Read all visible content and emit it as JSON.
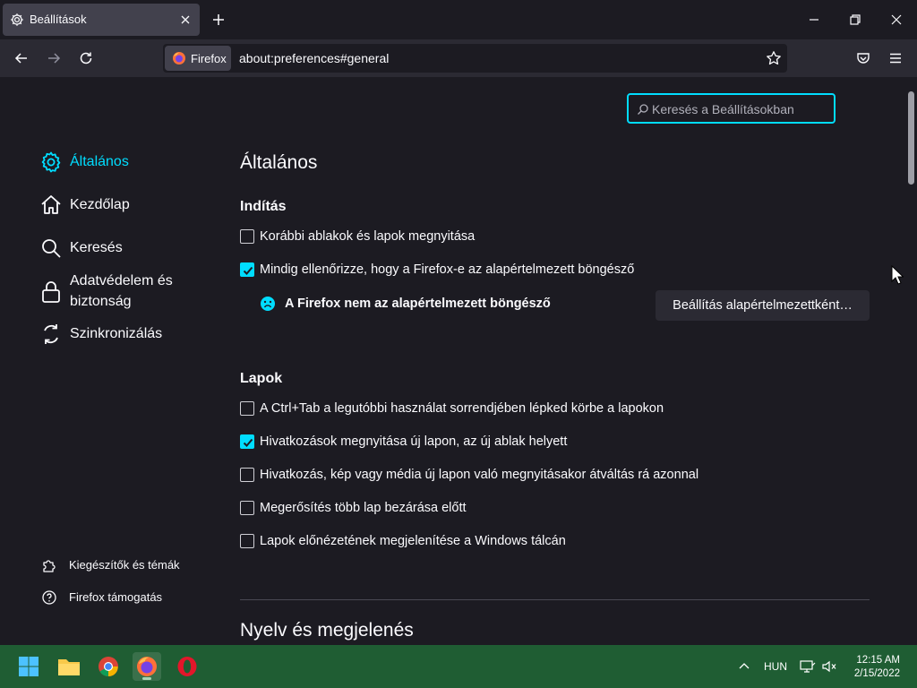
{
  "tab": {
    "title": "Beállítások"
  },
  "urlbar": {
    "identity_label": "Firefox",
    "url": "about:preferences#general"
  },
  "search": {
    "placeholder": "Keresés a Beállításokban"
  },
  "sidebar": {
    "items": [
      {
        "label": "Általános",
        "icon": "gear-icon",
        "active": true
      },
      {
        "label": "Kezdőlap",
        "icon": "home-icon"
      },
      {
        "label": "Keresés",
        "icon": "search-icon"
      },
      {
        "label": "Adatvédelem és biztonság",
        "icon": "lock-icon"
      },
      {
        "label": "Szinkronizálás",
        "icon": "sync-icon"
      }
    ],
    "footer": [
      {
        "label": "Kiegészítők és témák",
        "icon": "puzzle-icon"
      },
      {
        "label": "Firefox támogatás",
        "icon": "help-icon"
      }
    ]
  },
  "page": {
    "title": "Általános",
    "startup": {
      "heading": "Indítás",
      "restore_session": {
        "label": "Korábbi ablakok és lapok megnyitása",
        "checked": false
      },
      "check_default": {
        "label": "Mindig ellenőrizze, hogy a Firefox-e az alapértelmezett böngésző",
        "checked": true
      },
      "not_default_text": "A Firefox nem az alapértelmezett böngésző",
      "set_default_button": "Beállítás alapértelmezettként…"
    },
    "tabs": {
      "heading": "Lapok",
      "options": [
        {
          "label": "A Ctrl+Tab a legutóbbi használat sorrendjében lépked körbe a lapokon",
          "checked": false
        },
        {
          "label": "Hivatkozások megnyitása új lapon, az új ablak helyett",
          "checked": true
        },
        {
          "label": "Hivatkozás, kép vagy média új lapon való megnyitásakor átváltás rá azonnal",
          "checked": false
        },
        {
          "label": "Megerősítés több lap bezárása előtt",
          "checked": false
        },
        {
          "label": "Lapok előnézetének megjelenítése a Windows tálcán",
          "checked": false
        }
      ]
    },
    "language_heading": "Nyelv és megjelenés"
  },
  "taskbar": {
    "language": "HUN",
    "time": "12:15 AM",
    "date": "2/15/2022"
  },
  "colors": {
    "accent": "#00ddff",
    "taskbar": "#1f5d33",
    "background": "#1c1b22"
  }
}
